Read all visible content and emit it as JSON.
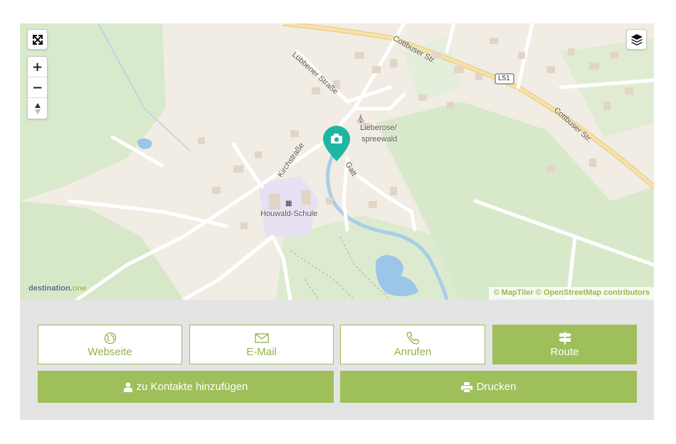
{
  "map": {
    "labels": {
      "road_luebbener": "Lübbener Straße",
      "road_cottbuser_1": "Cottbuser Str.",
      "road_cottbuser_2": "Cottbuser Str.",
      "road_l51": "L51",
      "road_kirch": "Kirchstraße",
      "road_gatt": "Gatt",
      "poi_lieberose": "Lieberose/",
      "poi_spreewald": "spreewald",
      "poi_school": "Houwald-Schule"
    },
    "attribution": "© MapTiler © OpenStreetMap contributors",
    "brand_prefix": "destination.",
    "brand_suffix": "one",
    "controls": {
      "fullscreen_icon": "expand-arrows-icon",
      "zoom_in": "+",
      "zoom_out": "−",
      "compass_icon": "north-arrow-icon",
      "layers_icon": "layers-icon"
    },
    "marker_icon": "camera-icon",
    "colors": {
      "marker": "#1fb5a3",
      "accent": "#9ebf5a"
    }
  },
  "actions": {
    "website": {
      "label": "Webseite",
      "icon": "globe-icon"
    },
    "email": {
      "label": "E-Mail",
      "icon": "envelope-icon"
    },
    "call": {
      "label": "Anrufen",
      "icon": "phone-icon"
    },
    "route": {
      "label": "Route",
      "icon": "signpost-icon"
    },
    "add_contact": {
      "label": "zu Kontakte hinzufügen",
      "icon": "user-icon"
    },
    "print": {
      "label": "Drucken",
      "icon": "printer-icon"
    }
  }
}
